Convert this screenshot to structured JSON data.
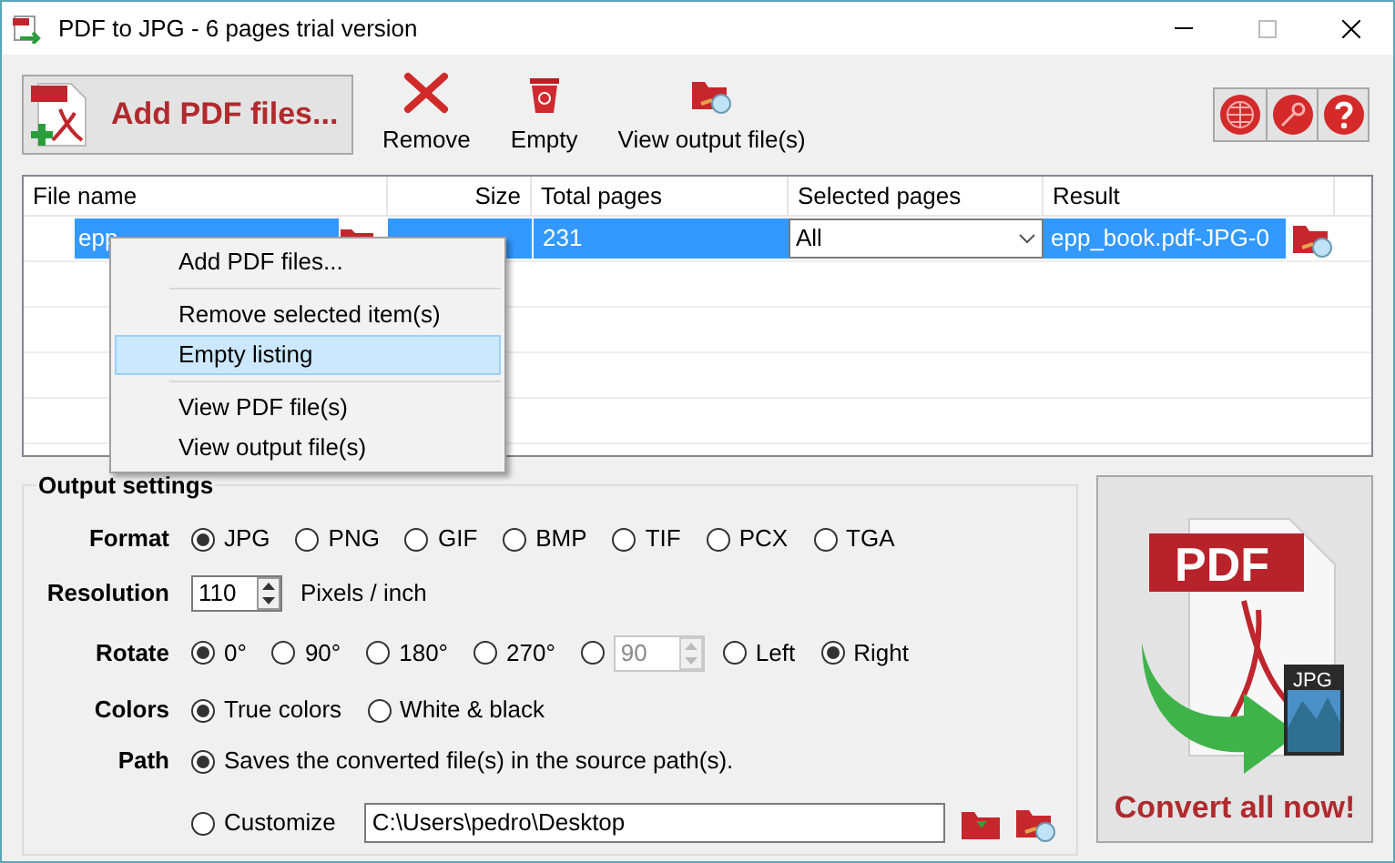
{
  "window": {
    "title": "PDF to JPG - 6 pages trial version"
  },
  "toolbar": {
    "add_button": "Add PDF files...",
    "buttons": [
      {
        "kind": "remove",
        "label": "Remove"
      },
      {
        "kind": "empty",
        "label": "Empty"
      },
      {
        "kind": "view",
        "label": "View output file(s)"
      }
    ],
    "corner_buttons": [
      {
        "kind": "globe"
      },
      {
        "kind": "key"
      },
      {
        "kind": "help"
      }
    ]
  },
  "table": {
    "columns": [
      "File name",
      "Size",
      "Total pages",
      "Selected pages",
      "Result"
    ],
    "rows": [
      {
        "selected": true,
        "file_name": "epp",
        "total_pages": "231",
        "selected_pages": "All",
        "result": "epp_book.pdf-JPG-0"
      }
    ]
  },
  "context_menu": {
    "items": [
      {
        "label": "Add PDF files...",
        "selected": false,
        "separator_after": true
      },
      {
        "label": "Remove selected item(s)",
        "selected": false,
        "separator_after": false
      },
      {
        "label": "Empty listing",
        "selected": true,
        "separator_after": true
      },
      {
        "label": "View PDF file(s)",
        "selected": false,
        "separator_after": false
      },
      {
        "label": "View output file(s)",
        "selected": false,
        "separator_after": false
      }
    ]
  },
  "output_settings": {
    "title": "Output settings",
    "format": {
      "label": "Format",
      "options": [
        {
          "label": "JPG",
          "selected": true
        },
        {
          "label": "PNG",
          "selected": false
        },
        {
          "label": "GIF",
          "selected": false
        },
        {
          "label": "BMP",
          "selected": false
        },
        {
          "label": "TIF",
          "selected": false
        },
        {
          "label": "PCX",
          "selected": false
        },
        {
          "label": "TGA",
          "selected": false
        }
      ]
    },
    "resolution": {
      "label": "Resolution",
      "value": "110",
      "unit": "Pixels / inch"
    },
    "rotate": {
      "label": "Rotate",
      "options": [
        {
          "label": "0°",
          "selected": true
        },
        {
          "label": "90°",
          "selected": false
        },
        {
          "label": "180°",
          "selected": false
        },
        {
          "label": "270°",
          "selected": false
        }
      ],
      "custom": {
        "selected": false,
        "value": "90",
        "disabled": true
      },
      "direction": [
        {
          "label": "Left",
          "selected": false
        },
        {
          "label": "Right",
          "selected": true
        }
      ]
    },
    "colors": {
      "label": "Colors",
      "options": [
        {
          "label": "True colors",
          "selected": true
        },
        {
          "label": "White & black",
          "selected": false
        }
      ]
    },
    "path": {
      "label": "Path",
      "source": {
        "label": "Saves the converted file(s) in the source path(s).",
        "selected": true
      },
      "customize": {
        "label": "Customize",
        "selected": false,
        "value": "C:\\Users\\pedro\\Desktop"
      }
    }
  },
  "convert": {
    "art_labels": [
      "PDF",
      "JPG"
    ],
    "label": "Convert all now!"
  }
}
